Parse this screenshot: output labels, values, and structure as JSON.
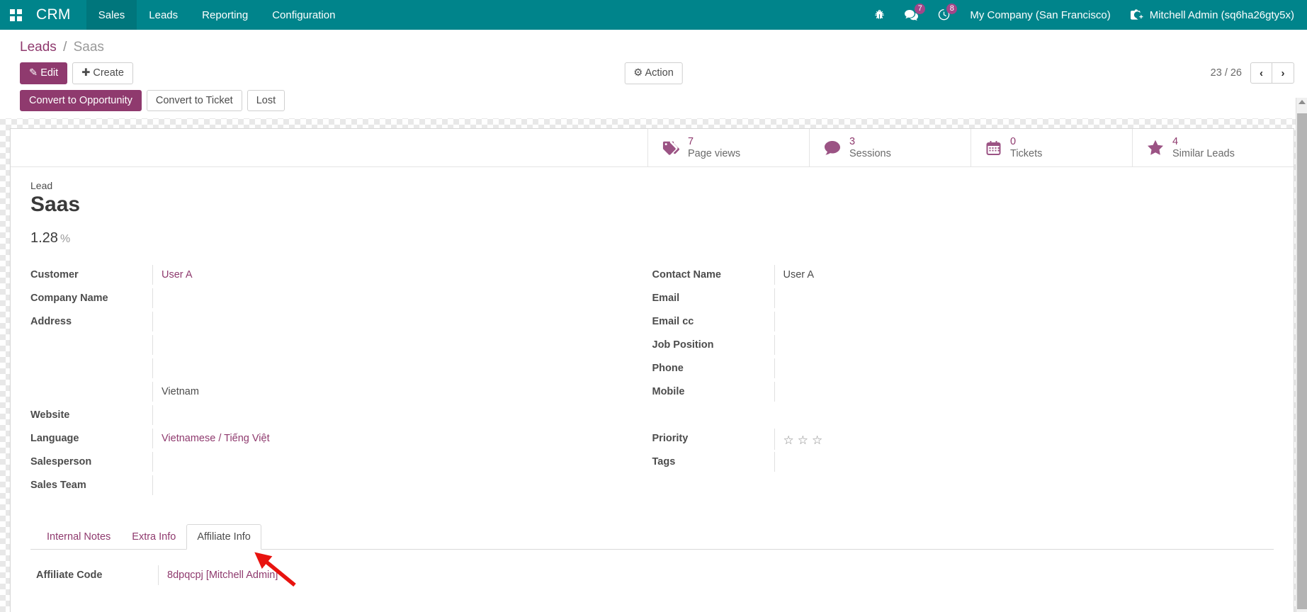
{
  "navbar": {
    "apps_icon": "apps-grid-icon",
    "brand": "CRM",
    "menu": [
      {
        "label": "Sales",
        "active": true
      },
      {
        "label": "Leads",
        "active": false
      },
      {
        "label": "Reporting",
        "active": false
      },
      {
        "label": "Configuration",
        "active": false
      }
    ],
    "sys_icons": [
      {
        "name": "bug-icon",
        "badge": ""
      },
      {
        "name": "messages-icon",
        "badge": "7"
      },
      {
        "name": "activities-clock-icon",
        "badge": "8"
      }
    ],
    "company": "My Company (San Francisco)",
    "user": "Mitchell Admin (sq6ha26gty5x)",
    "user_icon": "camera-avatar-icon",
    "bg_color": "#00848b"
  },
  "breadcrumb": {
    "root": "Leads",
    "separator": "/",
    "current": "Saas"
  },
  "control_panel": {
    "edit_label": "Edit",
    "create_label": "Create",
    "action_label": "Action",
    "pager_text": "23 / 26",
    "prev_icon": "chevron-left-icon",
    "next_icon": "chevron-right-icon",
    "edit_icon": "pencil-icon",
    "create_icon": "plus-icon",
    "action_icon": "gear-icon"
  },
  "statusbar": {
    "buttons": [
      {
        "label": "Convert to Opportunity",
        "primary": true
      },
      {
        "label": "Convert to Ticket",
        "primary": false
      },
      {
        "label": "Lost",
        "primary": false
      }
    ]
  },
  "stat_buttons": [
    {
      "icon": "tags-icon",
      "value": "7",
      "label": "Page views"
    },
    {
      "icon": "comment-icon",
      "value": "3",
      "label": "Sessions"
    },
    {
      "icon": "calendar-icon",
      "value": "0",
      "label": "Tickets"
    },
    {
      "icon": "star-icon",
      "value": "4",
      "label": "Similar Leads"
    }
  ],
  "lead": {
    "kicker": "Lead",
    "title": "Saas",
    "probability": "1.28",
    "probability_unit": "%"
  },
  "left_fields": [
    {
      "label": "Customer",
      "value": "User A",
      "link": true
    },
    {
      "label": "Company Name",
      "value": "",
      "link": false
    },
    {
      "label": "Address",
      "value": "",
      "link": false
    },
    {
      "label": "",
      "value": "",
      "link": false
    },
    {
      "label": "",
      "value": "",
      "link": false
    },
    {
      "label": "",
      "value": "Vietnam",
      "link": false
    },
    {
      "label": "Website",
      "value": "",
      "link": false
    },
    {
      "label": "Language",
      "value": "Vietnamese / Tiếng Việt",
      "link": true
    },
    {
      "label": "Salesperson",
      "value": "",
      "link": false
    },
    {
      "label": "Sales Team",
      "value": "",
      "link": false
    }
  ],
  "right_fields": [
    {
      "label": "Contact Name",
      "value": "User A",
      "link": false
    },
    {
      "label": "Email",
      "value": "",
      "link": false
    },
    {
      "label": "Email cc",
      "value": "",
      "link": false
    },
    {
      "label": "Job Position",
      "value": "",
      "link": false
    },
    {
      "label": "Phone",
      "value": "",
      "link": false
    },
    {
      "label": "Mobile",
      "value": "",
      "link": false
    }
  ],
  "priority": {
    "label": "Priority",
    "stars": 3,
    "filled": 0,
    "empty_glyph": "☆"
  },
  "tags": {
    "label": "Tags",
    "value": ""
  },
  "notebook": {
    "tabs": [
      {
        "label": "Internal Notes",
        "active": false
      },
      {
        "label": "Extra Info",
        "active": false
      },
      {
        "label": "Affiliate Info",
        "active": true
      }
    ],
    "affiliate": {
      "label": "Affiliate Code",
      "value": "8dpqcpj [Mitchell Admin]"
    }
  },
  "annotation": {
    "arrow_color": "#e8130f",
    "name": "red-pointer-arrow"
  }
}
